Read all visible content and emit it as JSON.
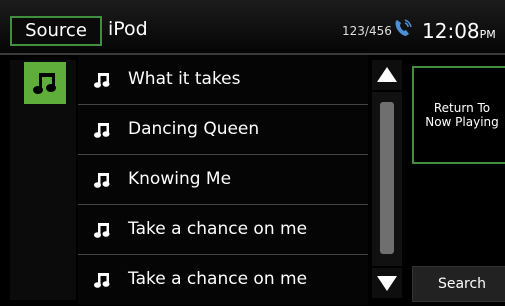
{
  "header": {
    "source_label": "Source",
    "source_name": "iPod",
    "track_counter": "123/456",
    "time": "12:08",
    "ampm": "PM"
  },
  "tracks": [
    {
      "title": "What it takes"
    },
    {
      "title": "Dancing Queen"
    },
    {
      "title": "Knowing Me"
    },
    {
      "title": "Take a chance on me"
    },
    {
      "title": "Take a chance on me"
    }
  ],
  "right_panel": {
    "return_line1": "Return To",
    "return_line2": "Now Playing",
    "search_label": "Search"
  },
  "colors": {
    "accent_green": "#5fae3c",
    "border_green": "#3f8f3f",
    "phone_blue": "#4a8fd8"
  },
  "icons": {
    "phone": "phone-icon",
    "music": "music-note-icon",
    "up": "arrow-up-icon",
    "down": "arrow-down-icon"
  }
}
